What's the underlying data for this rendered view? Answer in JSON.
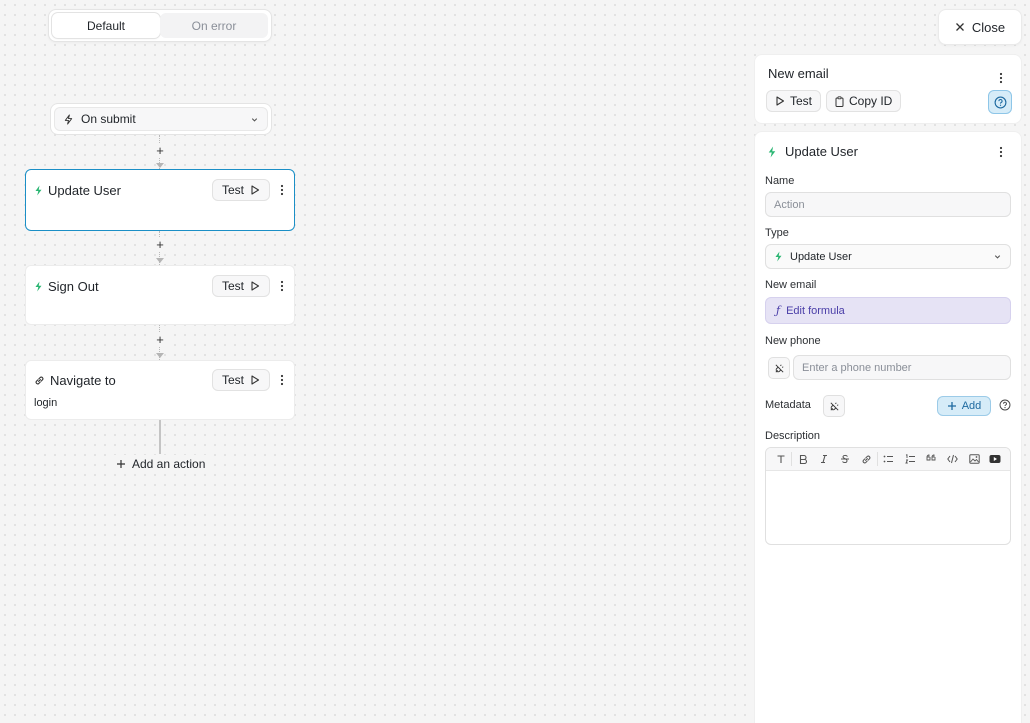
{
  "toggle": {
    "default_label": "Default",
    "error_label": "On error"
  },
  "trigger": {
    "label": "On submit"
  },
  "actions": [
    {
      "title": "Update User",
      "test_label": "Test",
      "subtitle": ""
    },
    {
      "title": "Sign Out",
      "test_label": "Test",
      "subtitle": ""
    },
    {
      "title": "Navigate to",
      "test_label": "Test",
      "subtitle": "login"
    }
  ],
  "add_action_label": "Add an action",
  "close_label": "Close",
  "workflow_panel": {
    "title": "New email",
    "test_label": "Test",
    "copy_id_label": "Copy ID"
  },
  "props_panel": {
    "title": "Update User",
    "name_label": "Name",
    "name_placeholder": "Action",
    "type_label": "Type",
    "type_value": "Update User",
    "email_label": "New email",
    "email_formula": "Edit formula",
    "phone_label": "New phone",
    "phone_placeholder": "Enter a phone number",
    "metadata_label": "Metadata",
    "add_label": "Add",
    "description_label": "Description"
  },
  "colors": {
    "accent": "#1b8fc6",
    "action_icon": "#2bb673",
    "formula_bg": "#e6e3f5"
  }
}
